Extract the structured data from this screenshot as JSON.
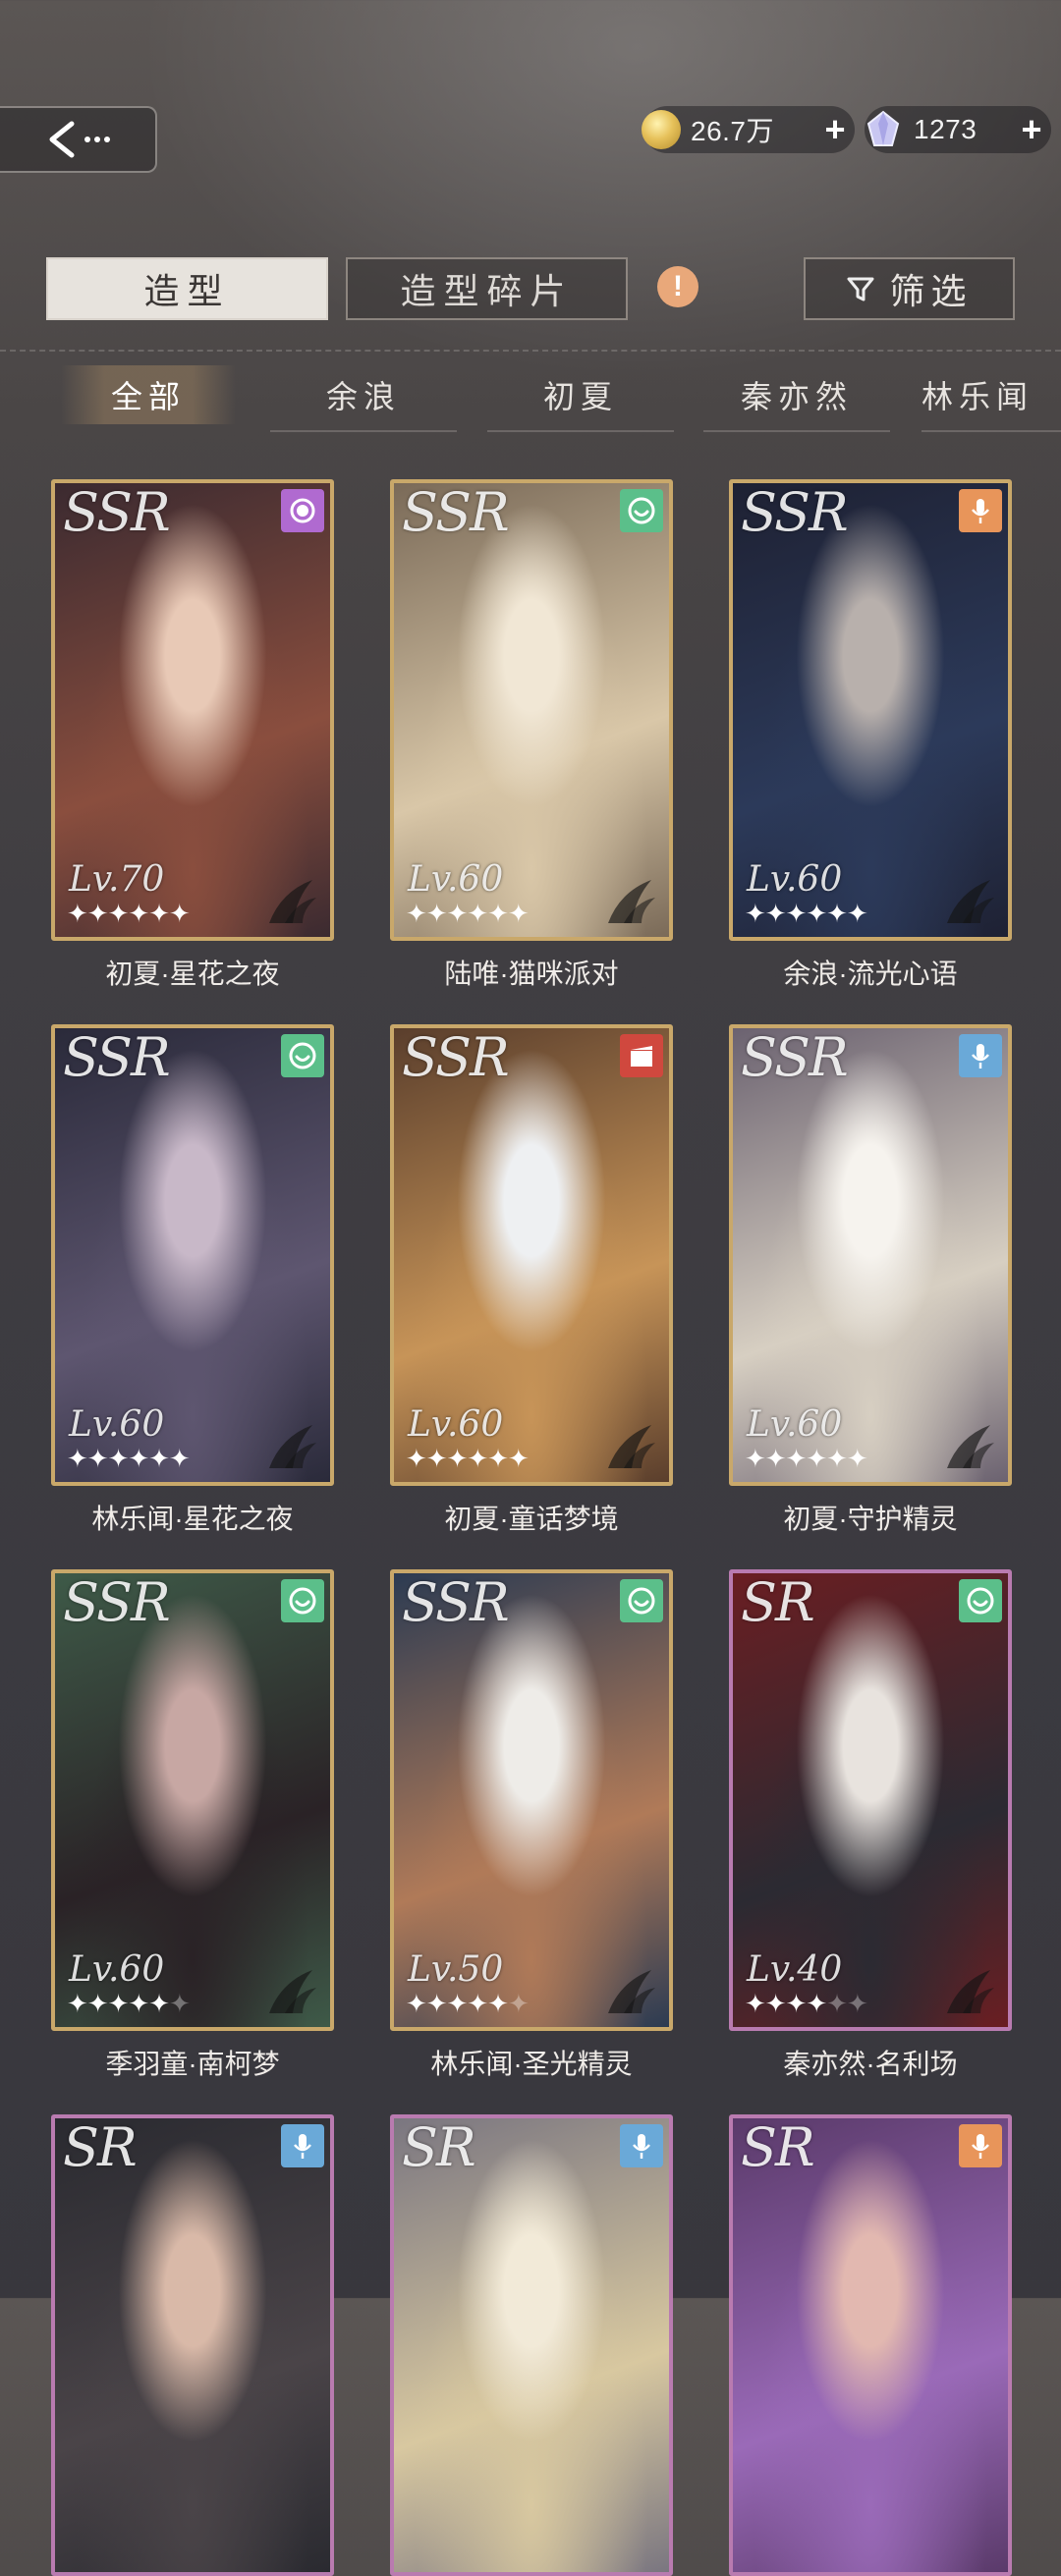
{
  "currency": {
    "gold": "26.7万",
    "gems": "1273",
    "plus": "+"
  },
  "tabs": {
    "active": "造型",
    "fragments": "造型碎片",
    "warning": "!",
    "filter": "筛选"
  },
  "characters": [
    "全部",
    "余浪",
    "初夏",
    "秦亦然",
    "林乐闻"
  ],
  "cards": [
    {
      "rarity": "SSR",
      "level": "Lv.70",
      "stars": 6,
      "name": "初夏·星花之夜",
      "badge": "moon-badge-icon",
      "badge_color": "#b06ad0",
      "colors": [
        "#3b2a30",
        "#8a4e3e",
        "#e8c9b6"
      ]
    },
    {
      "rarity": "SSR",
      "level": "Lv.60",
      "stars": 6,
      "name": "陆唯·猫咪派对",
      "badge": "smile-badge-icon",
      "badge_color": "#5bbf8a",
      "colors": [
        "#7a6a58",
        "#d9c7a8",
        "#f1e7d5"
      ]
    },
    {
      "rarity": "SSR",
      "level": "Lv.60",
      "stars": 6,
      "name": "余浪·流光心语",
      "badge": "mic-badge-icon",
      "badge_color": "#e8955a",
      "colors": [
        "#1e2133",
        "#2c3a5a",
        "#b8b0ac"
      ]
    },
    {
      "rarity": "SSR",
      "level": "Lv.60",
      "stars": 6,
      "name": "林乐闻·星花之夜",
      "badge": "smile-badge-icon",
      "badge_color": "#5bbf8a",
      "colors": [
        "#2a2a3a",
        "#5e5670",
        "#c8b8c8"
      ]
    },
    {
      "rarity": "SSR",
      "level": "Lv.60",
      "stars": 6,
      "name": "初夏·童话梦境",
      "badge": "film-badge-icon",
      "badge_color": "#d0483e",
      "colors": [
        "#5a3e2c",
        "#c79458",
        "#eef0f2"
      ]
    },
    {
      "rarity": "SSR",
      "level": "Lv.60",
      "stars": 6,
      "name": "初夏·守护精灵",
      "badge": "mic-badge-icon",
      "badge_color": "#6aa9d8",
      "colors": [
        "#6b6270",
        "#d7cfc2",
        "#f6f3ee"
      ]
    },
    {
      "rarity": "SSR",
      "level": "Lv.60",
      "stars": 5,
      "name": "季羽童·南柯梦",
      "badge": "smile-badge-icon",
      "badge_color": "#5bbf8a",
      "colors": [
        "#3e5a48",
        "#2a2226",
        "#c7a7a3"
      ]
    },
    {
      "rarity": "SSR",
      "level": "Lv.50",
      "stars": 5,
      "name": "林乐闻·圣光精灵",
      "badge": "smile-badge-icon",
      "badge_color": "#5bbf8a",
      "colors": [
        "#2c3b52",
        "#b07a58",
        "#eeece8"
      ]
    },
    {
      "rarity": "SR",
      "level": "Lv.40",
      "stars": 4,
      "name": "秦亦然·名利场",
      "badge": "smile-badge-icon",
      "badge_color": "#5bbf8a",
      "colors": [
        "#6a1e22",
        "#2b2a32",
        "#e8e3de"
      ]
    },
    {
      "rarity": "SR",
      "level": "",
      "stars": 0,
      "name": "",
      "badge": "mic-badge-icon",
      "badge_color": "#6aa9d8",
      "colors": [
        "#2a2a30",
        "#4a4448",
        "#d9b9a8"
      ]
    },
    {
      "rarity": "SR",
      "level": "",
      "stars": 0,
      "name": "",
      "badge": "mic-badge-icon",
      "badge_color": "#6aa9d8",
      "colors": [
        "#7a7680",
        "#d8c8a0",
        "#f2ead8"
      ]
    },
    {
      "rarity": "SR",
      "level": "",
      "stars": 0,
      "name": "",
      "badge": "mic-badge-icon",
      "badge_color": "#e8955a",
      "colors": [
        "#5a3a6a",
        "#9a6ab8",
        "#e2b8b0"
      ]
    }
  ]
}
